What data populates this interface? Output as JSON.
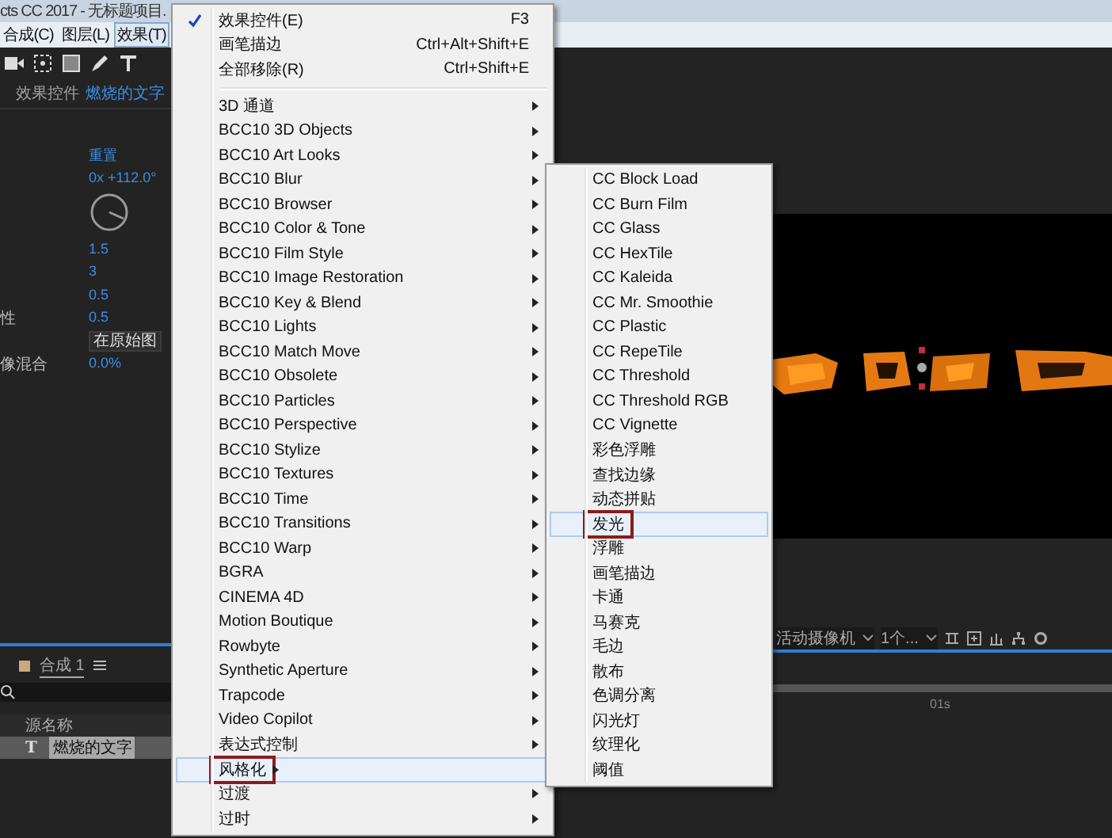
{
  "window": {
    "title": "cts CC 2017 - 无标题项目."
  },
  "menu_bar": [
    {
      "label": "合成(C)",
      "selected": false
    },
    {
      "label": "图层(L)",
      "selected": false
    },
    {
      "label": "效果(T)",
      "selected": true
    }
  ],
  "effect_controls": {
    "tab_label": "效果控件",
    "layer_name": "燃烧的文字",
    "rows": [
      {
        "kind": "link",
        "value": "重置"
      },
      {
        "kind": "value",
        "value": "0x +112.0°"
      },
      {
        "kind": "dial"
      },
      {
        "kind": "value",
        "value": "1.5"
      },
      {
        "kind": "value",
        "value": "3"
      },
      {
        "kind": "value",
        "value": "0.5"
      },
      {
        "kind": "value",
        "label": "性",
        "value": "0.5"
      },
      {
        "kind": "dropdown",
        "value": "在原始图"
      },
      {
        "kind": "value",
        "label": "像混合",
        "value": "0.0%"
      }
    ]
  },
  "viewer": {
    "camera": "活动摄像机",
    "views": "1个..."
  },
  "timeline": {
    "tab": "合成 1",
    "column_header": "源名称",
    "time_marker": "01s",
    "layers": [
      {
        "type_icon": "T",
        "name": "燃烧的文字",
        "selected": true
      }
    ]
  },
  "effect_menu": {
    "items": [
      {
        "kind": "item",
        "label": "效果控件(E)",
        "shortcut": "F3",
        "checked": true
      },
      {
        "kind": "item",
        "label": "画笔描边",
        "shortcut": "Ctrl+Alt+Shift+E",
        "checked": false
      },
      {
        "kind": "item",
        "label": "全部移除(R)",
        "shortcut": "Ctrl+Shift+E",
        "checked": false
      },
      {
        "kind": "separator"
      },
      {
        "kind": "submenu",
        "label": "3D 通道",
        "selected": false
      },
      {
        "kind": "submenu",
        "label": "BCC10 3D Objects",
        "selected": false
      },
      {
        "kind": "submenu",
        "label": "BCC10 Art Looks",
        "selected": false
      },
      {
        "kind": "submenu",
        "label": "BCC10 Blur",
        "selected": false
      },
      {
        "kind": "submenu",
        "label": "BCC10 Browser",
        "selected": false
      },
      {
        "kind": "submenu",
        "label": "BCC10 Color & Tone",
        "selected": false
      },
      {
        "kind": "submenu",
        "label": "BCC10 Film Style",
        "selected": false
      },
      {
        "kind": "submenu",
        "label": "BCC10 Image Restoration",
        "selected": false
      },
      {
        "kind": "submenu",
        "label": "BCC10 Key & Blend",
        "selected": false
      },
      {
        "kind": "submenu",
        "label": "BCC10 Lights",
        "selected": false
      },
      {
        "kind": "submenu",
        "label": "BCC10 Match Move",
        "selected": false
      },
      {
        "kind": "submenu",
        "label": "BCC10 Obsolete",
        "selected": false
      },
      {
        "kind": "submenu",
        "label": "BCC10 Particles",
        "selected": false
      },
      {
        "kind": "submenu",
        "label": "BCC10 Perspective",
        "selected": false
      },
      {
        "kind": "submenu",
        "label": "BCC10 Stylize",
        "selected": false
      },
      {
        "kind": "submenu",
        "label": "BCC10 Textures",
        "selected": false
      },
      {
        "kind": "submenu",
        "label": "BCC10 Time",
        "selected": false
      },
      {
        "kind": "submenu",
        "label": "BCC10 Transitions",
        "selected": false
      },
      {
        "kind": "submenu",
        "label": "BCC10 Warp",
        "selected": false
      },
      {
        "kind": "submenu",
        "label": "BGRA",
        "selected": false
      },
      {
        "kind": "submenu",
        "label": "CINEMA 4D",
        "selected": false
      },
      {
        "kind": "submenu",
        "label": "Motion Boutique",
        "selected": false
      },
      {
        "kind": "submenu",
        "label": "Rowbyte",
        "selected": false
      },
      {
        "kind": "submenu",
        "label": "Synthetic Aperture",
        "selected": false
      },
      {
        "kind": "submenu",
        "label": "Trapcode",
        "selected": false
      },
      {
        "kind": "submenu",
        "label": "Video Copilot",
        "selected": false
      },
      {
        "kind": "submenu",
        "label": "表达式控制",
        "selected": false
      },
      {
        "kind": "submenu",
        "label": "风格化",
        "selected": true
      },
      {
        "kind": "submenu",
        "label": "过渡",
        "selected": false
      },
      {
        "kind": "submenu",
        "label": "过时",
        "selected": false
      }
    ]
  },
  "stylize_submenu": {
    "items": [
      {
        "label": "CC Block Load",
        "selected": false
      },
      {
        "label": "CC Burn Film",
        "selected": false
      },
      {
        "label": "CC Glass",
        "selected": false
      },
      {
        "label": "CC HexTile",
        "selected": false
      },
      {
        "label": "CC Kaleida",
        "selected": false
      },
      {
        "label": "CC Mr. Smoothie",
        "selected": false
      },
      {
        "label": "CC Plastic",
        "selected": false
      },
      {
        "label": "CC RepeTile",
        "selected": false
      },
      {
        "label": "CC Threshold",
        "selected": false
      },
      {
        "label": "CC Threshold RGB",
        "selected": false
      },
      {
        "label": "CC Vignette",
        "selected": false
      },
      {
        "label": "彩色浮雕",
        "selected": false
      },
      {
        "label": "查找边缘",
        "selected": false
      },
      {
        "label": "动态拼贴",
        "selected": false
      },
      {
        "label": "发光",
        "selected": true
      },
      {
        "label": "浮雕",
        "selected": false
      },
      {
        "label": "画笔描边",
        "selected": false
      },
      {
        "label": "卡通",
        "selected": false
      },
      {
        "label": "马赛克",
        "selected": false
      },
      {
        "label": "毛边",
        "selected": false
      },
      {
        "label": "散布",
        "selected": false
      },
      {
        "label": "色调分离",
        "selected": false
      },
      {
        "label": "闪光灯",
        "selected": false
      },
      {
        "label": "纹理化",
        "selected": false
      },
      {
        "label": "阈值",
        "selected": false
      }
    ]
  }
}
